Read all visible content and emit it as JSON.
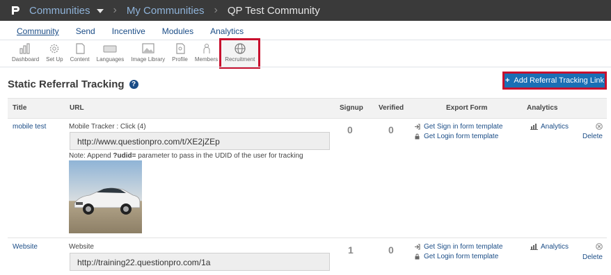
{
  "topbar": {
    "app": "Communities",
    "crumb1": "My Communities",
    "crumb2": "QP Test Community",
    "separator": "›"
  },
  "tabs": [
    "Community",
    "Send",
    "Incentive",
    "Modules",
    "Analytics"
  ],
  "toolbar": [
    {
      "label": "Dashboard",
      "icon": "bar-chart-icon"
    },
    {
      "label": "Set Up",
      "icon": "gear-icon"
    },
    {
      "label": "Content",
      "icon": "document-icon"
    },
    {
      "label": "Languages",
      "icon": "keyboard-icon"
    },
    {
      "label": "Image Library",
      "icon": "image-icon"
    },
    {
      "label": "Profile",
      "icon": "profile-icon"
    },
    {
      "label": "Members",
      "icon": "person-icon"
    },
    {
      "label": "Recruitment",
      "icon": "globe-icon"
    }
  ],
  "page": {
    "title": "Static Referral Tracking",
    "add_button": "Add Referral Tracking Link"
  },
  "table": {
    "headers": {
      "title": "Title",
      "url": "URL",
      "signup": "Signup",
      "verified": "Verified",
      "export": "Export Form",
      "analytics": "Analytics"
    },
    "rows": [
      {
        "title": "mobile test",
        "tracker": "Mobile Tracker : Click (4)",
        "url": "http://www.questionpro.com/t/XE2jZEp",
        "note_prefix": "Note: Append ",
        "note_param": "?udid=",
        "note_suffix": " parameter to pass in the UDID of the user for tracking",
        "signup": "0",
        "verified": "0",
        "export_signin": "Get Sign in form template",
        "export_login": "Get Login form template",
        "analytics": "Analytics",
        "delete": "Delete"
      },
      {
        "title": "Website",
        "tracker": "Website",
        "url": "http://training22.questionpro.com/1a",
        "signup": "1",
        "verified": "0",
        "export_signin": "Get Sign in form template",
        "export_login": "Get Login form template",
        "analytics": "Analytics",
        "delete": "Delete"
      }
    ]
  },
  "colors": {
    "topbar": "#3a3a3a",
    "link": "#1a4c86",
    "button": "#1a6fb5",
    "highlight": "#c8102e"
  }
}
